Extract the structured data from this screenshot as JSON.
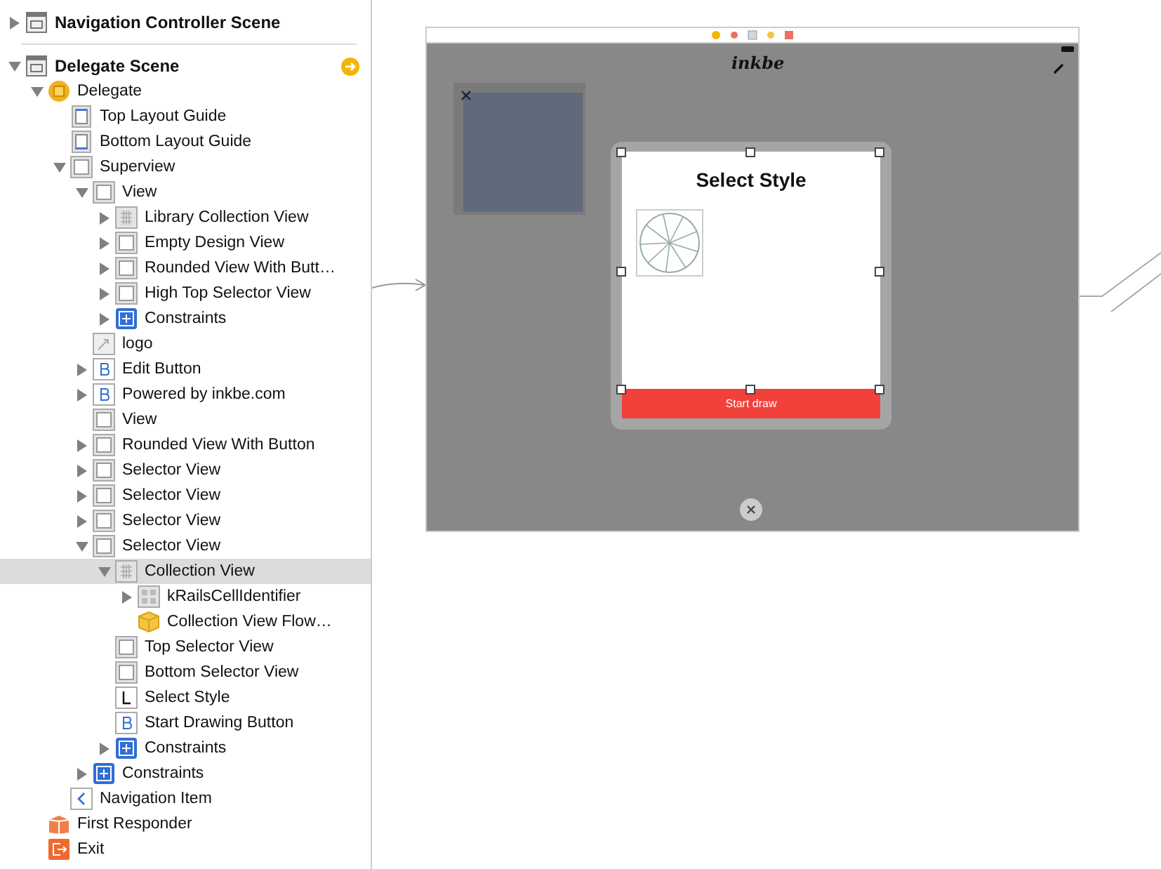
{
  "outline": [
    {
      "label": "Navigation Controller Scene",
      "kind": "scene",
      "expanded": false,
      "selected": false,
      "separator": true,
      "segue_badge": false
    },
    {
      "label": "Delegate Scene",
      "kind": "scene",
      "expanded": true,
      "selected": false,
      "segue_badge": true,
      "children": [
        {
          "label": "Delegate",
          "kind": "controller",
          "expanded": true,
          "selected": false,
          "children": [
            {
              "label": "Top Layout Guide",
              "kind": "guide-top",
              "selected": false
            },
            {
              "label": "Bottom Layout Guide",
              "kind": "guide-bottom",
              "selected": false
            },
            {
              "label": "Superview",
              "kind": "view",
              "expanded": true,
              "selected": false,
              "children": [
                {
                  "label": "View",
                  "kind": "view",
                  "expanded": true,
                  "selected": false,
                  "children": [
                    {
                      "label": "Library Collection View",
                      "kind": "collection",
                      "expanded": false,
                      "selected": false
                    },
                    {
                      "label": "Empty Design View",
                      "kind": "view",
                      "expanded": false,
                      "selected": false
                    },
                    {
                      "label": "Rounded View With Butt…",
                      "kind": "view",
                      "expanded": false,
                      "selected": false
                    },
                    {
                      "label": "High Top Selector View",
                      "kind": "view",
                      "expanded": false,
                      "selected": false
                    },
                    {
                      "label": "Constraints",
                      "kind": "constraints",
                      "expanded": false,
                      "selected": false
                    }
                  ]
                },
                {
                  "label": "logo",
                  "kind": "image",
                  "selected": false
                },
                {
                  "label": "Edit Button",
                  "kind": "button",
                  "expanded": false,
                  "selected": false
                },
                {
                  "label": "Powered by inkbe.com",
                  "kind": "button",
                  "expanded": false,
                  "selected": false
                },
                {
                  "label": "View",
                  "kind": "view",
                  "selected": false
                },
                {
                  "label": "Rounded View With Button",
                  "kind": "view",
                  "expanded": false,
                  "selected": false
                },
                {
                  "label": "Selector View",
                  "kind": "view",
                  "expanded": false,
                  "selected": false
                },
                {
                  "label": "Selector View",
                  "kind": "view",
                  "expanded": false,
                  "selected": false
                },
                {
                  "label": "Selector View",
                  "kind": "view",
                  "expanded": false,
                  "selected": false
                },
                {
                  "label": "Selector View",
                  "kind": "view",
                  "expanded": true,
                  "selected": false,
                  "children": [
                    {
                      "label": "Collection View",
                      "kind": "collection",
                      "expanded": true,
                      "selected": true,
                      "children": [
                        {
                          "label": "kRailsCellIdentifier",
                          "kind": "cell",
                          "expanded": false,
                          "selected": false
                        },
                        {
                          "label": "Collection View Flow…",
                          "kind": "object",
                          "selected": false
                        }
                      ]
                    },
                    {
                      "label": "Top Selector View",
                      "kind": "view",
                      "selected": false
                    },
                    {
                      "label": "Bottom Selector View",
                      "kind": "view",
                      "selected": false
                    },
                    {
                      "label": "Select Style",
                      "kind": "label",
                      "selected": false
                    },
                    {
                      "label": "Start Drawing Button",
                      "kind": "button",
                      "selected": false
                    },
                    {
                      "label": "Constraints",
                      "kind": "constraints",
                      "expanded": false,
                      "selected": false
                    }
                  ]
                },
                {
                  "label": "Constraints",
                  "kind": "constraints",
                  "expanded": false,
                  "selected": false
                }
              ]
            },
            {
              "label": "Navigation Item",
              "kind": "nav-item",
              "selected": false
            }
          ]
        },
        {
          "label": "First Responder",
          "kind": "responder",
          "selected": false
        },
        {
          "label": "Exit",
          "kind": "exit",
          "selected": false
        }
      ]
    }
  ],
  "canvas": {
    "logo": "inkbe",
    "card": {
      "title": "Select Style",
      "button": "Start draw"
    }
  }
}
